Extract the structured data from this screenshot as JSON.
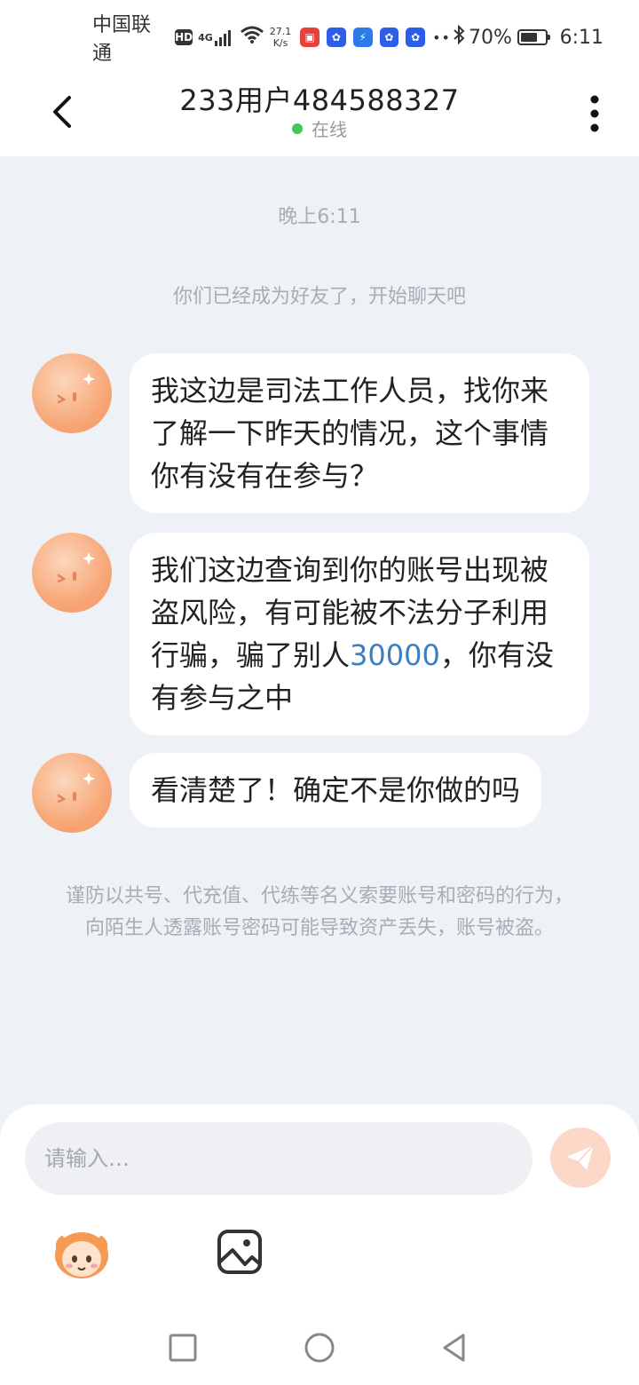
{
  "status_bar": {
    "carrier": "中国联通",
    "hd": "HD",
    "net": "4G",
    "speed_value": "27.1",
    "speed_unit": "K/s",
    "more": "••",
    "battery_percent": "70%",
    "battery_level": 0.7,
    "time": "6:11"
  },
  "header": {
    "title": "233用户484588327",
    "status": "在线",
    "status_color": "#3ec85f"
  },
  "chat": {
    "time_label": "晚上6:11",
    "system_message": "你们已经成为好友了，开始聊天吧",
    "messages": [
      {
        "text": "我这边是司法工作人员，找你来了解一下昨天的情况，这个事情你有没有在参与？"
      },
      {
        "text_before": "我们这边查询到你的账号出现被盗风险，有可能被不法分子利用行骗，骗了别人",
        "highlight": "30000",
        "text_after": "，你有没有参与之中"
      },
      {
        "text": "看清楚了！确定不是你做的吗"
      }
    ],
    "warning": "谨防以共号、代充值、代练等名义索要账号和密码的行为，向陌生人透露账号密码可能导致资产丢失，账号被盗。"
  },
  "input": {
    "placeholder": "请输入…",
    "value": ""
  },
  "colors": {
    "accent": "#f7a878",
    "link": "#3a7fc1",
    "background": "#eef2f7"
  },
  "icons": {
    "back": "chevron-left-icon",
    "more": "more-vertical-icon",
    "send": "paper-plane-icon",
    "emoji": "emoji-sticker-icon",
    "image": "image-icon",
    "nav_recent": "square-icon",
    "nav_home": "circle-icon",
    "nav_back": "triangle-back-icon"
  }
}
